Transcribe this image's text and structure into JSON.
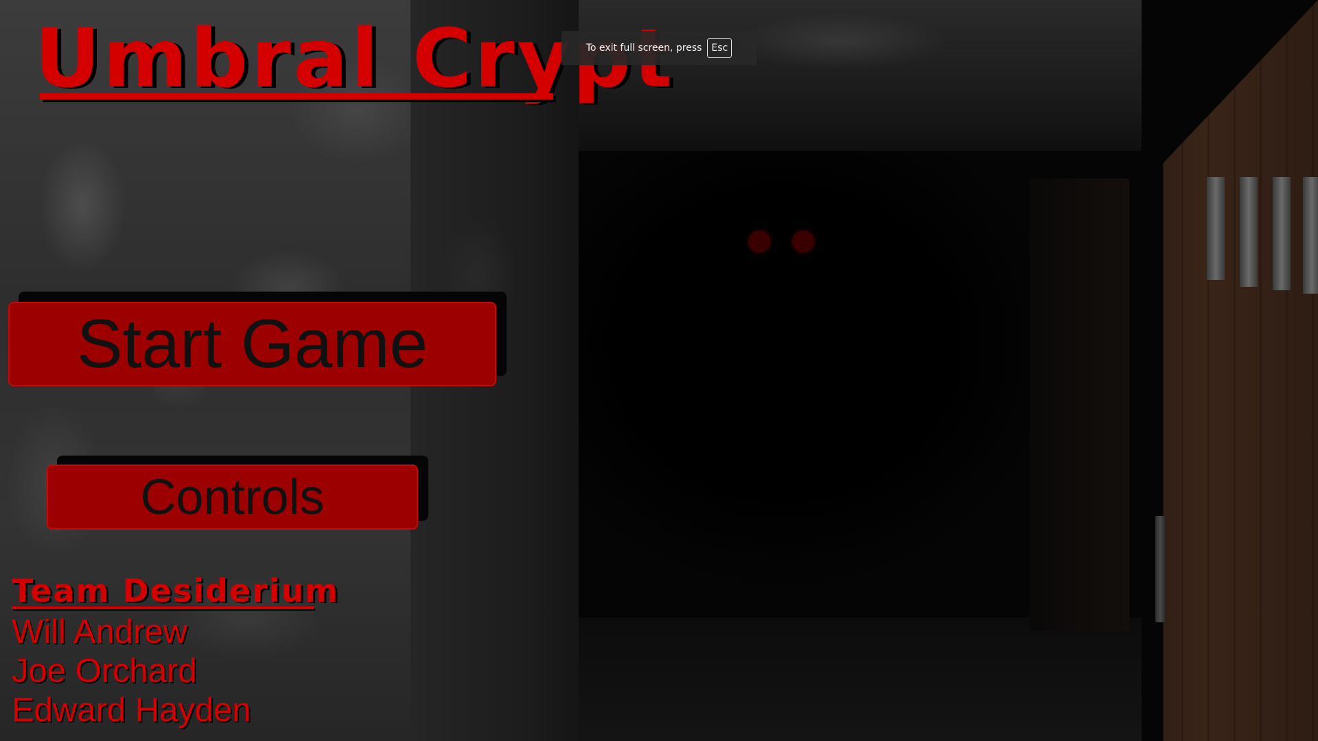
{
  "game": {
    "title": "Umbral Crypt"
  },
  "menu": {
    "start_label": "Start Game",
    "controls_label": "Controls"
  },
  "credits": {
    "team_name": "Team Desiderium",
    "members": [
      "Will Andrew",
      "Joe Orchard",
      "Edward Hayden"
    ]
  },
  "fullscreen_notice": {
    "text": "To exit full screen, press",
    "key": "Esc"
  },
  "colors": {
    "accent_red": "#d40000",
    "button_fill": "#9c0000",
    "eye_red": "#3a0000"
  }
}
